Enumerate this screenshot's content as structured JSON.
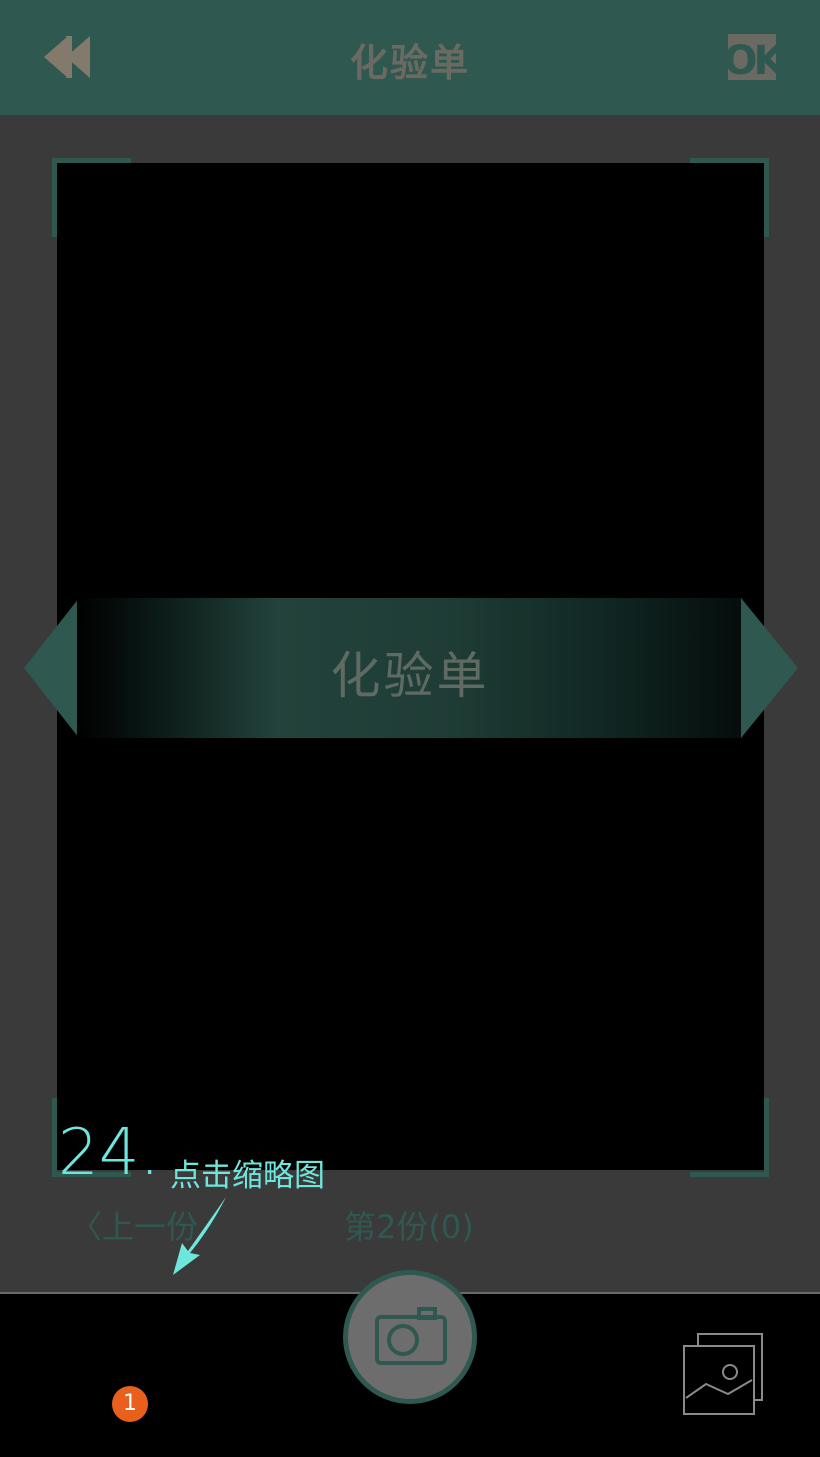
{
  "header": {
    "title": "化验单",
    "back_icon": "double-chevron-left-icon",
    "ok_label": "OK"
  },
  "viewfinder": {
    "banner_label": "化验单",
    "left_arrow_icon": "triangle-left-icon",
    "right_arrow_icon": "triangle-right-icon"
  },
  "annotation": {
    "step_number": "24.",
    "instruction": "点击缩略图"
  },
  "navigation": {
    "prev_label": "〈上一份",
    "page_info": "第2份(0)"
  },
  "bottom": {
    "shutter_icon": "camera-icon",
    "badge_count": "1",
    "gallery_icon": "gallery-icon"
  },
  "colors": {
    "accent": "#2f5850",
    "annotation": "#6fe6dc",
    "badge": "#e8601c"
  }
}
